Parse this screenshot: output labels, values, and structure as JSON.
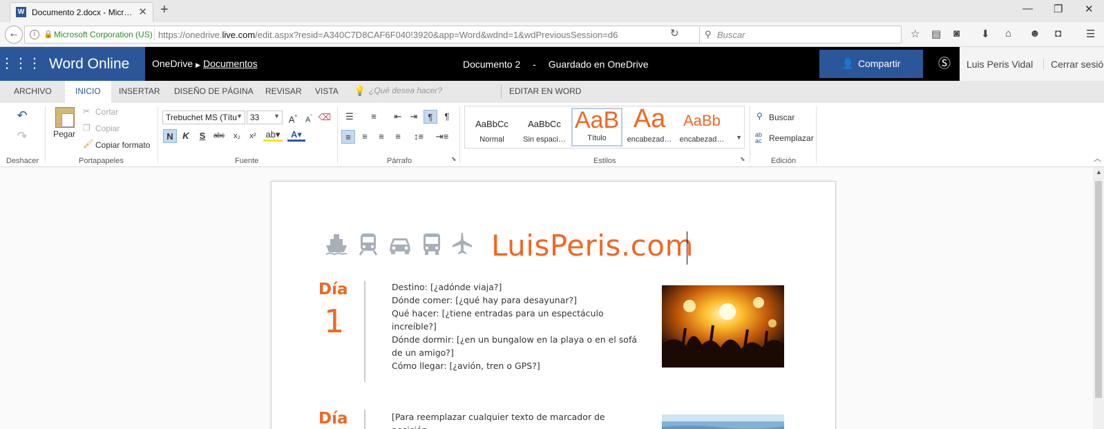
{
  "browser": {
    "tab_title": "Documento 2.docx - Micr…",
    "tab_icon_letter": "W",
    "site_identity": "Microsoft Corporation (US)",
    "url_prefix": "https://onedrive.",
    "url_domain": "live.com",
    "url_suffix": "/edit.aspx?resid=A340C7D8CAF6F040!3920&app=Word&wdnd=1&wdPreviousSession=d6",
    "search_placeholder": "Buscar"
  },
  "app": {
    "name": "Word Online",
    "breadcrumb_root": "OneDrive",
    "breadcrumb_folder": "Documentos",
    "document_name": "Documento 2",
    "save_status_sep": "-",
    "save_status": "Guardado en OneDrive",
    "share_label": "Compartir",
    "user_name": "Luis Peris Vidal",
    "sign_out": "Cerrar sesión"
  },
  "ribbon_tabs": [
    "ARCHIVO",
    "INICIO",
    "INSERTAR",
    "DISEÑO DE PÁGINA",
    "REVISAR",
    "VISTA"
  ],
  "tell_me_placeholder": "¿Qué desea hacer?",
  "edit_in_word": "EDITAR EN WORD",
  "ribbon": {
    "groups": [
      "Deshacer",
      "Portapapeles",
      "Fuente",
      "Párrafo",
      "Estilos",
      "Edición"
    ],
    "paste": "Pegar",
    "cut": "Cortar",
    "copy": "Copiar",
    "format_painter": "Copiar formato",
    "font_name": "Trebuchet MS (Títu",
    "font_size": "33",
    "bold": "N",
    "italic": "K",
    "underline": "S",
    "strike": "abc",
    "sub": "x₂",
    "sup": "x²",
    "styles": [
      {
        "preview": "AaBbCc",
        "name": "Normal"
      },
      {
        "preview": "AaBbCc",
        "name": "Sin espaci…"
      },
      {
        "preview": "AaB",
        "name": "Título"
      },
      {
        "preview": "Aa",
        "name": "encabezad…"
      },
      {
        "preview": "AaBb",
        "name": "encabezad…"
      }
    ],
    "find": "Buscar",
    "replace": "Reemplazar"
  },
  "document": {
    "site_title": "LuisPeris.com",
    "days": [
      {
        "label": "Día",
        "number": "1",
        "lines": [
          "Destino: [¿adónde viaja?]",
          "Dónde comer: [¿qué hay para desayunar?]",
          "Qué hacer: [¿tiene entradas para un espectáculo increíble?]",
          "Dónde dormir: [¿en un bungalow en la playa o en el sofá de un amigo?]",
          "Cómo llegar: [¿avión, tren o GPS?]"
        ]
      },
      {
        "label": "Día",
        "lines": [
          "[Para reemplazar cualquier texto de marcador de posición"
        ]
      }
    ]
  },
  "colors": {
    "word_blue": "#2b579a",
    "accent_orange": "#f26722",
    "icon_gray": "#a7b0b8"
  }
}
